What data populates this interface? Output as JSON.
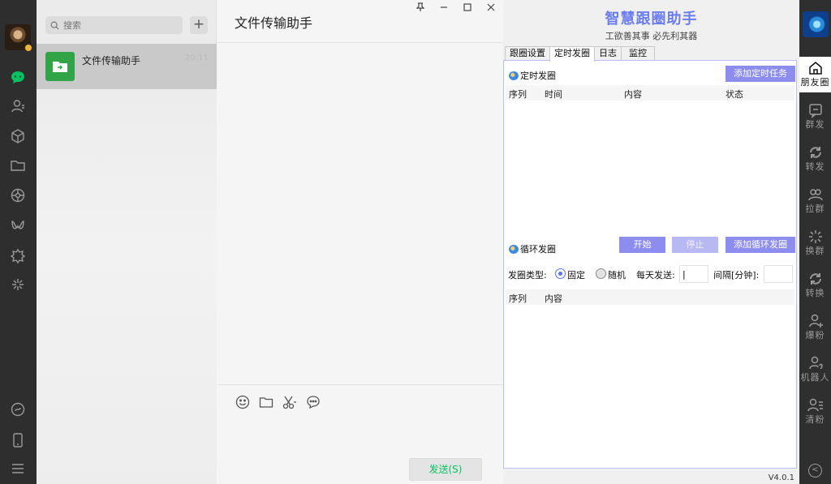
{
  "chat": {
    "search_placeholder": "搜索",
    "add_label": "+",
    "items": [
      {
        "name": "文件传输助手",
        "time": "20:11"
      }
    ]
  },
  "conversation": {
    "title": "文件传输助手",
    "send_label": "发送(S)"
  },
  "assistant": {
    "title": "智慧跟圈助手",
    "subtitle": "工欲善其事  必先利其器",
    "tabs": [
      "跟圈设置",
      "定时发圈",
      "日志",
      "监控"
    ],
    "active_tab": "定时发圈",
    "scheduled": {
      "label": "定时发圈",
      "add_button": "添加定时任务",
      "columns": [
        "序列",
        "时间",
        "内容",
        "状态"
      ]
    },
    "loop": {
      "label": "循环发圈",
      "start_button": "开始",
      "stop_button": "停止",
      "add_button": "添加循环发圈",
      "type_label": "发圈类型:",
      "option_fixed": "固定",
      "option_random": "随机",
      "selected": "固定",
      "daily_label": "每天发送:",
      "daily_value": "|",
      "interval_label": "间隔[分钟]:",
      "interval_value": "",
      "columns": [
        "序列",
        "内容"
      ]
    },
    "version": "V4.0.1"
  },
  "right_rail": {
    "items": [
      "朋友圈",
      "群发",
      "转发",
      "拉群",
      "换群",
      "转换",
      "爆粉",
      "机器人",
      "清粉"
    ],
    "active": "朋友圈",
    "collapse_label": "<"
  },
  "colors": {
    "accent": "#8d8df0",
    "title": "#6c7df0",
    "wechat_green": "#07c160",
    "rail_bg": "#2e2e2e"
  }
}
